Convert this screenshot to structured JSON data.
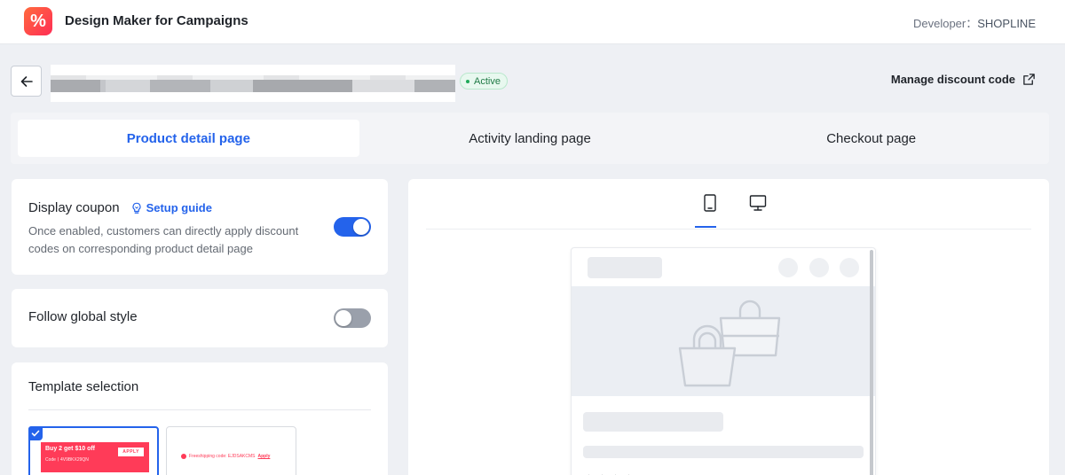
{
  "app": {
    "logo_glyph": "%",
    "title": "Design Maker for Campaigns",
    "developer_label": "Developer：",
    "developer_name": "SHOPLINE"
  },
  "header": {
    "status": "Active",
    "manage_link": "Manage discount code",
    "back_icon": "arrow-left-icon",
    "external_icon": "external-link-icon"
  },
  "tabs": [
    {
      "label": "Product detail page",
      "active": true
    },
    {
      "label": "Activity landing page",
      "active": false
    },
    {
      "label": "Checkout page",
      "active": false
    }
  ],
  "display_coupon": {
    "title": "Display coupon",
    "setup_guide": "Setup guide",
    "description": "Once enabled, customers can directly apply discount codes on corresponding product detail page",
    "enabled": true
  },
  "follow_global": {
    "title": "Follow global style",
    "enabled": false
  },
  "template_selection": {
    "title": "Template selection",
    "templates": [
      {
        "title": "Buy 2 get $10 off",
        "code": "Code丨4V9BKX29QN",
        "apply": "APPLY",
        "selected": true
      },
      {
        "text": "Freeshipping code: EJDSAKCMS",
        "apply": "Apply",
        "selected": false
      }
    ]
  },
  "preview": {
    "devices": [
      "mobile-icon",
      "desktop-icon"
    ],
    "active_device": "mobile"
  },
  "colors": {
    "accent": "#2463eb",
    "brand_gradient_start": "#ff6a3d",
    "brand_gradient_end": "#ff2d55",
    "status_green": "#1faa59",
    "coupon_red": "#ff3b58"
  }
}
